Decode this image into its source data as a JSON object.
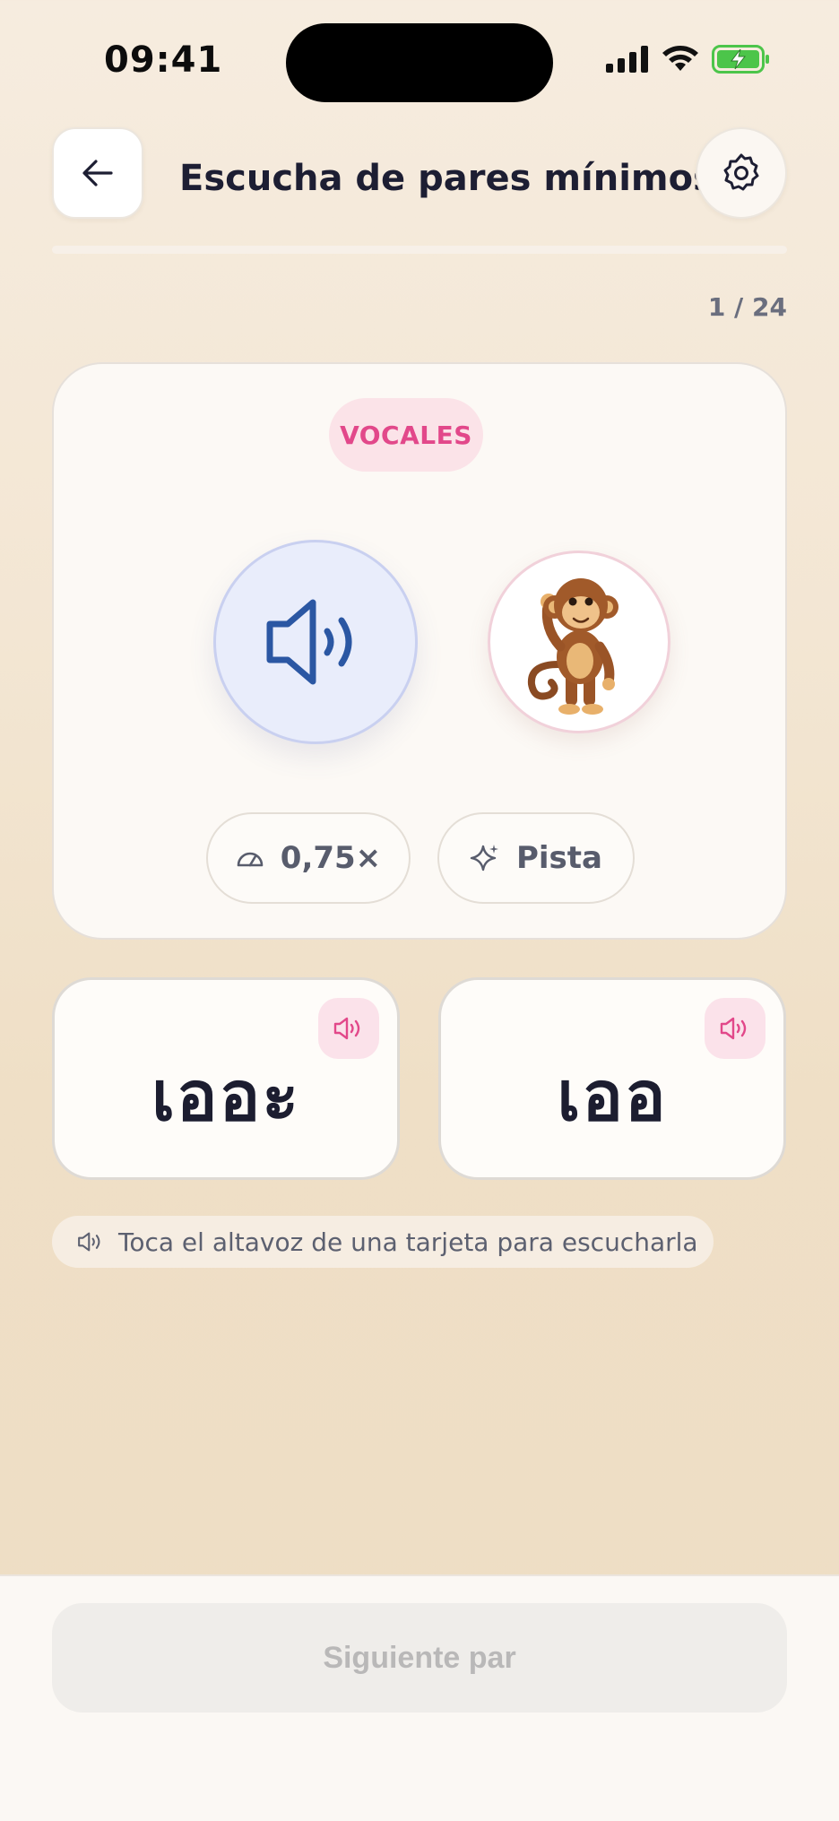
{
  "status_bar": {
    "time": "09:41"
  },
  "header": {
    "title": "Escucha de pares mínimos"
  },
  "progress": {
    "current": 1,
    "total": 24,
    "label": "1 / 24",
    "fraction": 0.0
  },
  "main_card": {
    "category": "VOCALES",
    "speed_label": "0,75×",
    "hint_label": "Pista"
  },
  "options": [
    {
      "text": "เออะ"
    },
    {
      "text": "เออ"
    }
  ],
  "tip": {
    "text": "Toca el altavoz de una tarjeta para escucharla"
  },
  "footer": {
    "next_label": "Siguiente par"
  },
  "colors": {
    "accent_pink": "#e2488a",
    "play_blue": "#2b57a3",
    "battery_green": "#4cc54a"
  },
  "icons": [
    "back-arrow-icon",
    "gear-icon",
    "speaker-icon",
    "monkey-image",
    "speedometer-icon",
    "sparkle-icon"
  ]
}
